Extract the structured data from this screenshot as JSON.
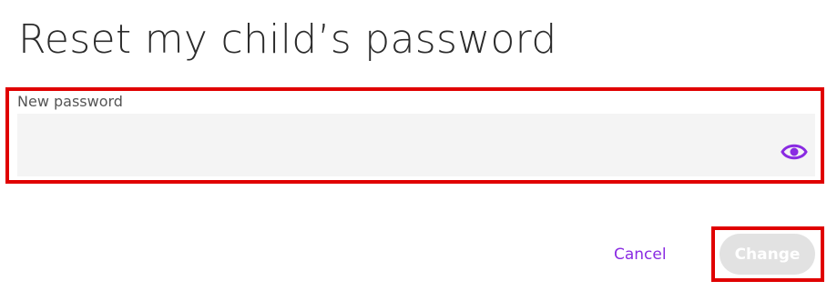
{
  "dialog": {
    "title": "Reset my child’s password"
  },
  "password_field": {
    "label": "New password",
    "value": "",
    "placeholder": "",
    "toggle_icon": "eye-icon"
  },
  "actions": {
    "cancel_label": "Cancel",
    "change_label": "Change",
    "change_enabled": false
  },
  "colors": {
    "accent": "#8a2be2",
    "highlight": "#e00000",
    "disabled_button": "#e2e2e2",
    "input_background": "#f4f4f4"
  }
}
